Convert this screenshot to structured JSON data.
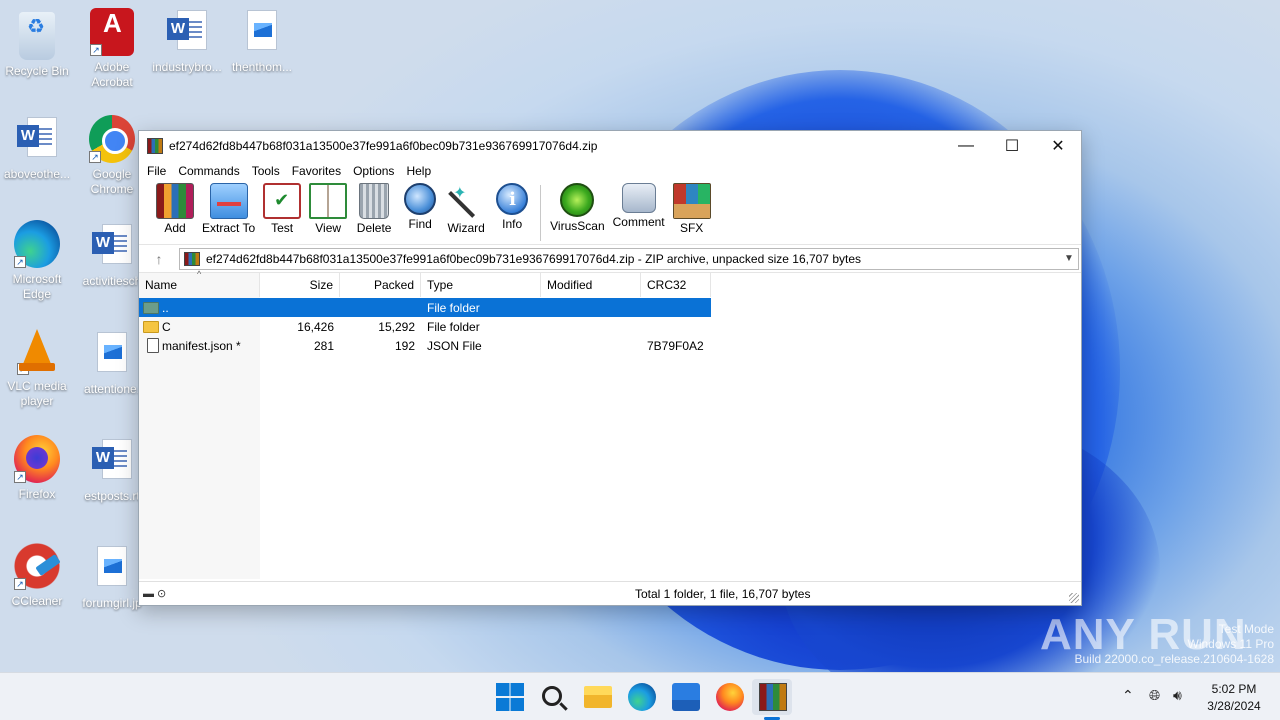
{
  "desktop": {
    "icons": [
      {
        "label": "Recycle Bin"
      },
      {
        "label": "Adobe Acrobat"
      },
      {
        "label": "industrybro..."
      },
      {
        "label": "thenthom..."
      },
      {
        "label": "aboveothe..."
      },
      {
        "label": "Google Chrome"
      },
      {
        "label": "Microsoft Edge"
      },
      {
        "label": "activitiesch"
      },
      {
        "label": "VLC media player"
      },
      {
        "label": "attentione."
      },
      {
        "label": "Firefox"
      },
      {
        "label": "estposts.rt"
      },
      {
        "label": "CCleaner"
      },
      {
        "label": "forumgirl.jp"
      }
    ]
  },
  "window": {
    "title": "ef274d62fd8b447b68f031a13500e37fe991a6f0bec09b731e936769917076d4.zip",
    "controls": {
      "minimize": "—",
      "maximize": "☐",
      "close": "✕"
    },
    "menu": [
      "File",
      "Commands",
      "Tools",
      "Favorites",
      "Options",
      "Help"
    ],
    "toolbar": [
      {
        "label": "Add",
        "icon": "add-archive-icon"
      },
      {
        "label": "Extract To",
        "icon": "extract-folder-icon"
      },
      {
        "label": "Test",
        "icon": "test-clipboard-icon"
      },
      {
        "label": "View",
        "icon": "view-book-icon"
      },
      {
        "label": "Delete",
        "icon": "trash-icon"
      },
      {
        "label": "Find",
        "icon": "magnifier-icon"
      },
      {
        "label": "Wizard",
        "icon": "magic-wand-icon"
      },
      {
        "label": "Info",
        "icon": "info-icon"
      },
      {
        "label": "VirusScan",
        "icon": "bug-icon"
      },
      {
        "label": "Comment",
        "icon": "comment-icon"
      },
      {
        "label": "SFX",
        "icon": "sfx-box-icon"
      }
    ],
    "address": "ef274d62fd8b447b68f031a13500e37fe991a6f0bec09b731e936769917076d4.zip - ZIP archive, unpacked size 16,707 bytes",
    "columns": [
      "Name",
      "Size",
      "Packed",
      "Type",
      "Modified",
      "CRC32"
    ],
    "rows": [
      {
        "name": "..",
        "size": "",
        "packed": "",
        "type": "File folder",
        "modified": "",
        "crc": ""
      },
      {
        "name": "C",
        "size": "16,426",
        "packed": "15,292",
        "type": "File folder",
        "modified": "",
        "crc": ""
      },
      {
        "name": "manifest.json *",
        "size": "281",
        "packed": "192",
        "type": "JSON File",
        "modified": "",
        "crc": "7B79F0A2"
      }
    ],
    "status": "Total 1 folder, 1 file, 16,707 bytes"
  },
  "watermark": {
    "brand": "ANY RUN",
    "lines": [
      "Test Mode",
      "Windows 11 Pro",
      "Build 22000.co_release.210604-1628"
    ]
  },
  "taskbar": {
    "time": "5:02 PM",
    "date": "3/28/2024"
  },
  "colors": {
    "selection": "#0a72d6",
    "taskbar_bg": "#eef1f6",
    "accent": "#0a7ad6"
  }
}
